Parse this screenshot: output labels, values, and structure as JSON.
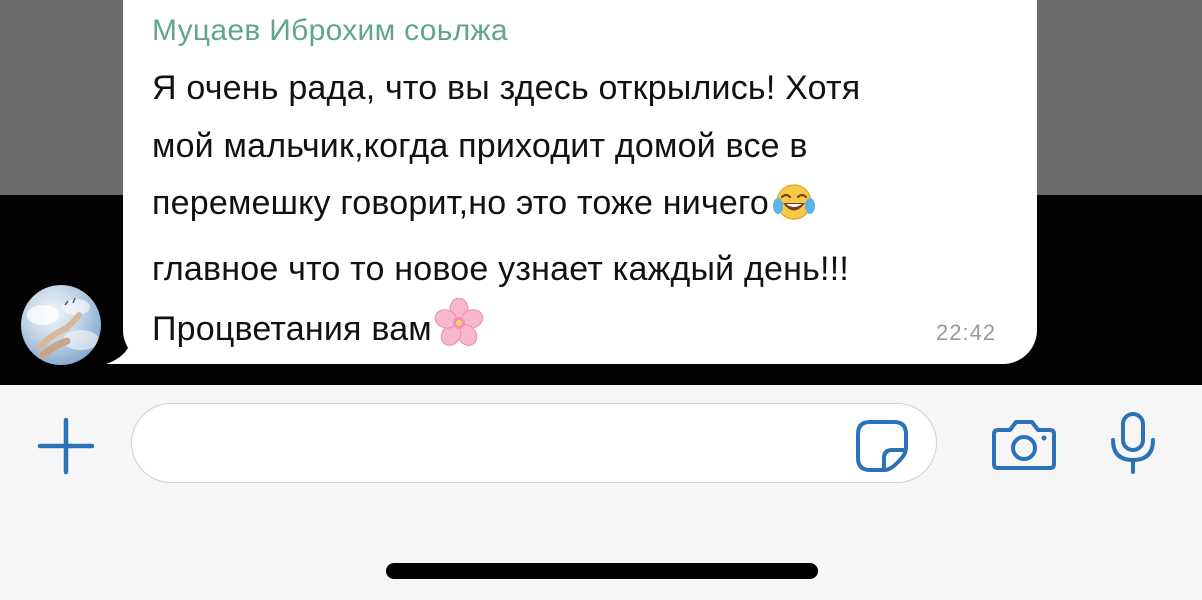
{
  "message": {
    "sender": "Муцаев Иброхим соьлжа",
    "lines": [
      "Я очень рада, что вы здесь открылись! Хотя",
      "мой мальчик,когда приходит домой все в",
      "перемешку говорит,но это тоже ничего",
      "главное что то новое узнает каждый день!!!",
      "Процветания вам"
    ],
    "emoji_line3": "face-with-tears-of-joy",
    "emoji_line5": "cherry-blossom",
    "time": "22:42"
  },
  "colors": {
    "accent": "#2a73b8",
    "sender_name": "#5fa58f",
    "bubble": "#ffffff",
    "background_top": "#6b6b6b",
    "background_bottom": "#020202"
  },
  "input_bar": {
    "text_value": "",
    "icons": [
      "plus-icon",
      "sticker-icon",
      "camera-icon",
      "microphone-icon"
    ]
  }
}
